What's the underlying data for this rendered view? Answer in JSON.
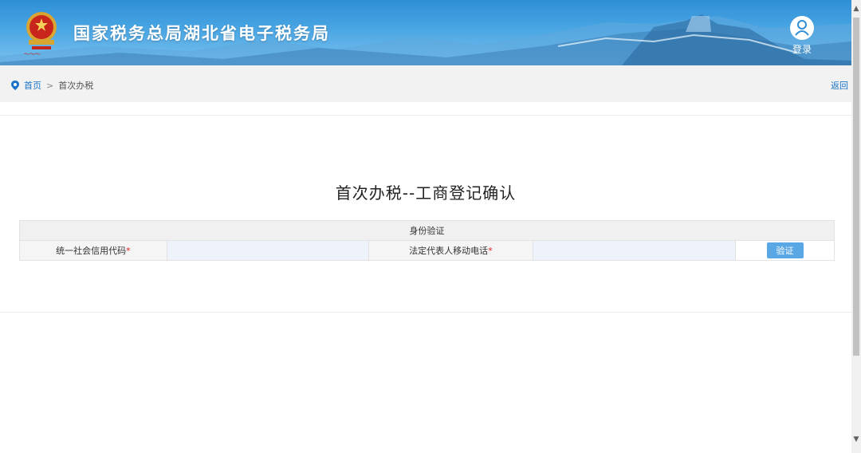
{
  "header": {
    "site_title": "国家税务总局湖北省电子税务局",
    "login_label": "登录"
  },
  "breadcrumb": {
    "home": "首页",
    "separator": ">",
    "current": "首次办税",
    "back": "返回"
  },
  "main": {
    "heading": "首次办税--工商登记确认",
    "section_title": "身份验证",
    "fields": [
      {
        "label": "统一社会信用代码",
        "required_mark": "*",
        "value": ""
      },
      {
        "label": "法定代表人移动电话",
        "required_mark": "*",
        "value": ""
      }
    ],
    "verify_button": "验证"
  },
  "colors": {
    "header_blue": "#2f8fd6",
    "link_blue": "#1a73c9",
    "button_blue": "#5aa7e6",
    "required_red": "#e02020"
  },
  "icons": [
    "emblem-icon",
    "user-icon",
    "location-pin-icon",
    "scroll-up-icon",
    "scroll-down-icon"
  ]
}
